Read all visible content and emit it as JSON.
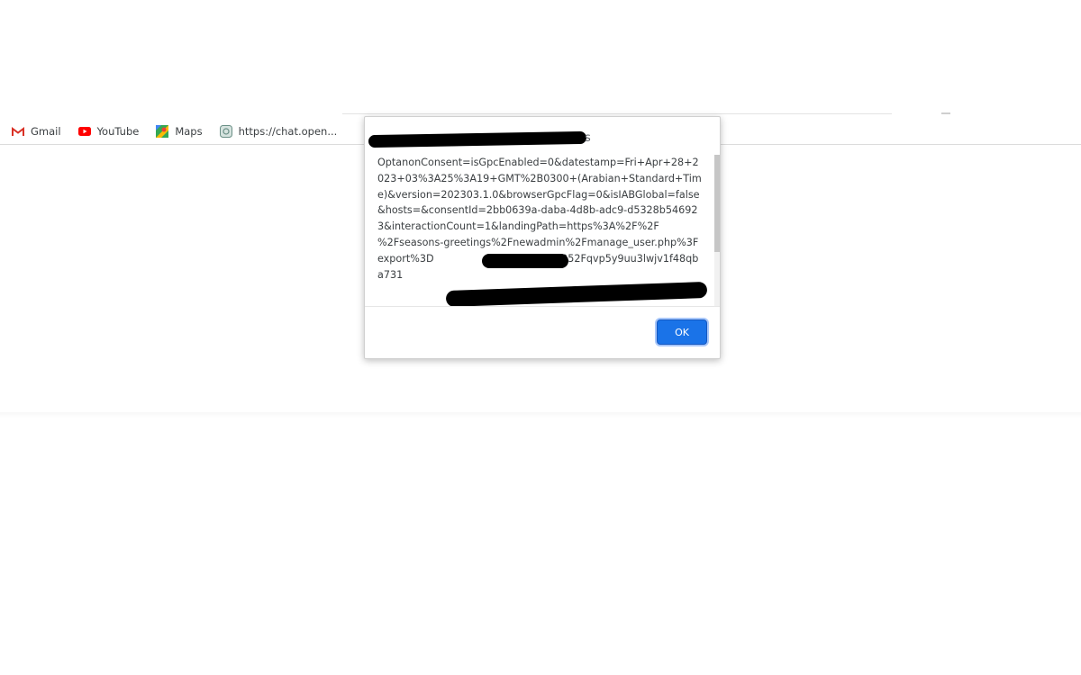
{
  "bookmarks": [
    {
      "label": "Gmail",
      "icon": "gmail-icon"
    },
    {
      "label": "YouTube",
      "icon": "youtube-icon"
    },
    {
      "label": "Maps",
      "icon": "maps-icon"
    },
    {
      "label": "https://chat.open...",
      "icon": "chat-icon"
    }
  ],
  "dialog": {
    "title_suffix": "s",
    "message": "OptanonConsent=isGpcEnabled=0&datestamp=Fri+Apr+28+2023+03%3A25%3A19+GMT%2B0300+(Arabian+Standard+Time)&version=202303.1.0&browserGpcFlag=0&isIABGlobal=false&hosts=&consentId=2bb0639a-daba-4d8b-adc9-d5328b546923&interactionCount=1&landingPath=https%3A%2F%2F            %2Fseasons-greetings%2Fnewadmin%2Fmanage_user.php%3Fexport%3D                          %252F%252Fqvp5y9uu3lwjv1f48qba731",
    "ok_label": "OK"
  },
  "colors": {
    "accent": "#1a73e8",
    "text": "#3c4043"
  }
}
